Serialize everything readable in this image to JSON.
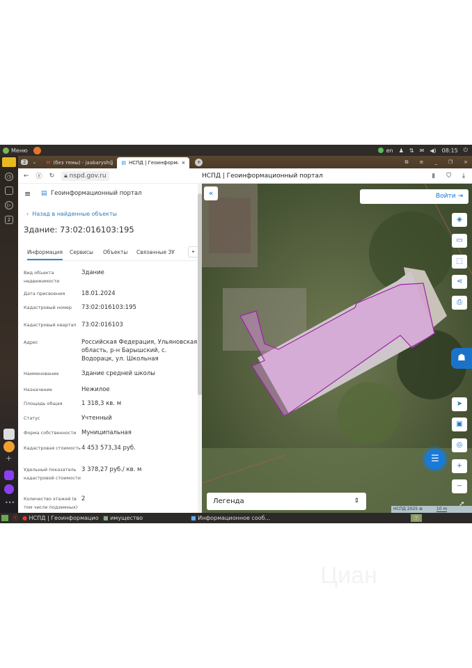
{
  "system": {
    "menu": "Меню",
    "lang": "en",
    "clock": "08:15"
  },
  "browser": {
    "tabs": [
      {
        "label": "(без темы) - jaabarysh@"
      },
      {
        "label": "НСПД | Геоинформацио"
      }
    ],
    "url": "nspd.gov.ru",
    "page_title": "НСПД | Геоинформационный портал",
    "tab_count": "2"
  },
  "portal": {
    "title": "Геоинформационный портал",
    "back": "Назад в найденные объекты",
    "heading": "Здание: 73:02:016103:195",
    "tabs": [
      "Информация",
      "Сервисы",
      "Объекты",
      "Связанные ЗУ"
    ],
    "fields": [
      {
        "label": "Вид объекта недвижимости",
        "value": "Здание"
      },
      {
        "label": "Дата присвоения",
        "value": "18.01.2024"
      },
      {
        "label": "Кадастровый номер",
        "value": "73:02:016103:195"
      },
      {
        "label": "Кадастровый квартал",
        "value": "73:02:016103"
      },
      {
        "label": "Адрес",
        "value": "Российская Федерация, Ульяновская область, р-н Барышский, с. Водорацк, ул. Школьная"
      },
      {
        "label": "Наименование",
        "value": "Здание средней школы"
      },
      {
        "label": "Назначение",
        "value": "Нежилое"
      },
      {
        "label": "Площадь общая",
        "value": "1 318,3 кв. м"
      },
      {
        "label": "Статус",
        "value": "Учтенный"
      },
      {
        "label": "Форма собственности",
        "value": "Муниципальная"
      },
      {
        "label": "Кадастровая стоимость",
        "value": "4 453 573,34 руб."
      },
      {
        "label": "Удельный показатель кадастровой стоимости",
        "value": "3 378,27 руб./ кв. м"
      },
      {
        "label": "Количество этажей (в том числе подземных)",
        "value": "2"
      }
    ]
  },
  "map": {
    "login": "Войти",
    "legend": "Легенда",
    "attribution": "НСПД 2025",
    "scale": "10 m",
    "parcel_color": "#d98be0"
  },
  "taskbar": {
    "items": [
      "НСПД | Геоинформацио...",
      "имущество",
      "Информационное сооб..."
    ]
  },
  "watermark": "Циан"
}
